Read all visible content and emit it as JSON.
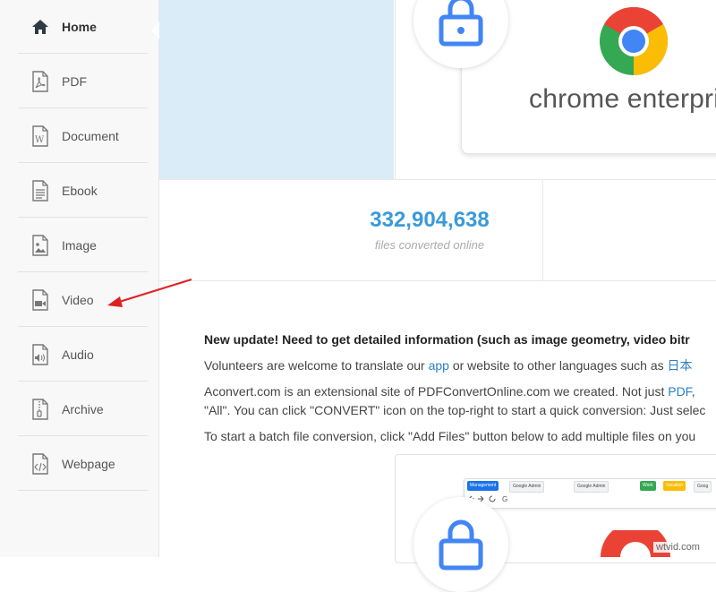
{
  "sidebar": {
    "items": [
      {
        "label": "Home",
        "icon": "home-icon",
        "active": true
      },
      {
        "label": "PDF",
        "icon": "pdf-file-icon"
      },
      {
        "label": "Document",
        "icon": "word-document-icon"
      },
      {
        "label": "Ebook",
        "icon": "ebook-file-icon"
      },
      {
        "label": "Image",
        "icon": "image-file-icon"
      },
      {
        "label": "Video",
        "icon": "video-file-icon"
      },
      {
        "label": "Audio",
        "icon": "audio-file-icon"
      },
      {
        "label": "Archive",
        "icon": "archive-file-icon"
      },
      {
        "label": "Webpage",
        "icon": "webpage-file-icon"
      }
    ]
  },
  "banner": {
    "brand_text": "chrome enterpris"
  },
  "stats": {
    "count": "332,904,638",
    "caption": "files converted online"
  },
  "content": {
    "headline": "New update! Need to get detailed information (such as image geometry, video bitr",
    "p1_prefix": "Volunteers are welcome to translate our ",
    "p1_link_app": "app",
    "p1_middle": " or website to other languages such as ",
    "p1_link_lang": "日本",
    "p2_line1_prefix": "Aconvert.com is an extensional site of PDFConvertOnline.com we created. Not just ",
    "p2_link_pdf": "PDF",
    "p2_line1_suffix": ", ",
    "p2_line2": "\"All\". You can click \"CONVERT\" icon on the top-right to start a quick conversion: Just selec",
    "p3": "To start a batch file conversion, click \"Add Files\" button below to add multiple files on you"
  },
  "browser_preview": {
    "tabs": [
      "Management",
      "Google Admin",
      "Google Admin",
      "Work",
      "Vacation",
      "Goog"
    ]
  },
  "watermark": "wtvid.com",
  "colors": {
    "accent": "#3a9ad9",
    "link": "#2a7fc9",
    "banner_bg": "#d9ecf8",
    "arrow": "#e02020",
    "google_blue": "#4285f4",
    "google_red": "#ea4335",
    "google_yellow": "#fbbc05",
    "google_green": "#34a853"
  }
}
